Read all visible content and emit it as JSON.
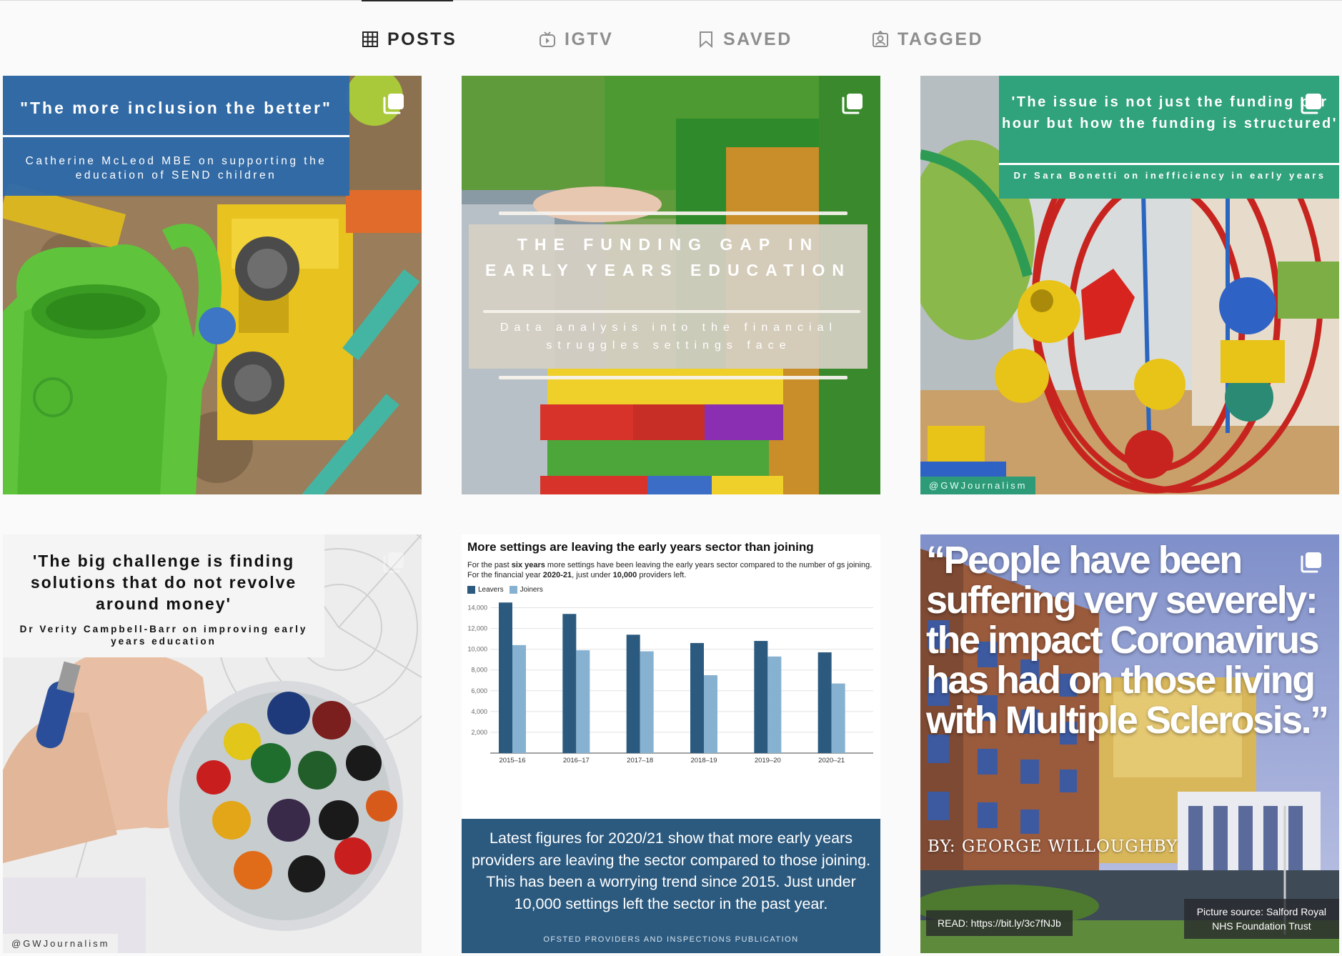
{
  "tabs": [
    {
      "label": "POSTS",
      "icon": "grid-icon",
      "active": true
    },
    {
      "label": "IGTV",
      "icon": "igtv-icon",
      "active": false
    },
    {
      "label": "SAVED",
      "icon": "bookmark-icon",
      "active": false
    },
    {
      "label": "TAGGED",
      "icon": "tagged-icon",
      "active": false
    }
  ],
  "colors": {
    "active_tab": "#262626",
    "inactive_tab": "#8e8e8e",
    "post1_band": "#2f6aa8",
    "post3_band": "#30a27c",
    "post5_footer": "#2c5a7f",
    "leavers": "#2c5a7f",
    "joiners": "#86b1d0"
  },
  "posts": [
    {
      "title": "\"The more inclusion the better\"",
      "subtitle": "Catherine McLeod MBE on supporting the education of SEND children",
      "multiple": true
    },
    {
      "title": "THE FUNDING GAP IN EARLY YEARS EDUCATION",
      "subtitle": "Data analysis into the financial struggles settings face",
      "multiple": true
    },
    {
      "title": "'The issue is not just the funding per hour but how the funding is structured'",
      "subtitle": "Dr Sara Bonetti on inefficiency in early years",
      "handle": "@GWJournalism",
      "multiple": true
    },
    {
      "title": "'The big challenge is finding solutions that do not revolve around money'",
      "subtitle": "Dr Verity Campbell-Barr on improving early years education",
      "handle": "@GWJournalism",
      "multiple": true
    },
    {
      "chart_title": "More settings are leaving the early years sector than joining",
      "desc_1": "For the past ",
      "desc_b1": "six years",
      "desc_2": " more settings have been leaving the early years sector compared to the number of",
      "desc_3": "gs joining. For the financial year ",
      "desc_b2": "2020-21",
      "desc_4": ", just under ",
      "desc_b3": "10,000",
      "desc_5": " providers left.",
      "footer_text": "Latest figures for 2020/21 show that more early years providers are leaving the sector compared to those joining. This has been a worrying trend since 2015. Just under 10,000 settings left the sector in the past year.",
      "source": "OFSTED PROVIDERS AND INSPECTIONS PUBLICATION"
    },
    {
      "quote": "“People have been suffering very severely: the impact Coronavirus has had on those living with Multiple Sclerosis.”",
      "byline": "BY: GEORGE WILLOUGHBY",
      "read": "READ: https://bit.ly/3c7fNJb",
      "picture_source_1": "Picture source: Salford Royal",
      "picture_source_2": "NHS Foundation Trust",
      "multiple": true
    }
  ],
  "chart_data": {
    "type": "bar",
    "title": "More settings are leaving the early years sector than joining",
    "categories": [
      "2015–16",
      "2016–17",
      "2017–18",
      "2018–19",
      "2019–20",
      "2020–21"
    ],
    "series": [
      {
        "name": "Leavers",
        "values": [
          14500,
          13400,
          11400,
          10600,
          10800,
          9700
        ]
      },
      {
        "name": "Joiners",
        "values": [
          10400,
          9900,
          9800,
          7500,
          9300,
          6700
        ]
      }
    ],
    "yticks": [
      "2,000",
      "4,000",
      "6,000",
      "8,000",
      "10,000",
      "12,000",
      "14,000"
    ],
    "ylim": [
      0,
      15000
    ],
    "legend": "top-left",
    "grid": true
  }
}
